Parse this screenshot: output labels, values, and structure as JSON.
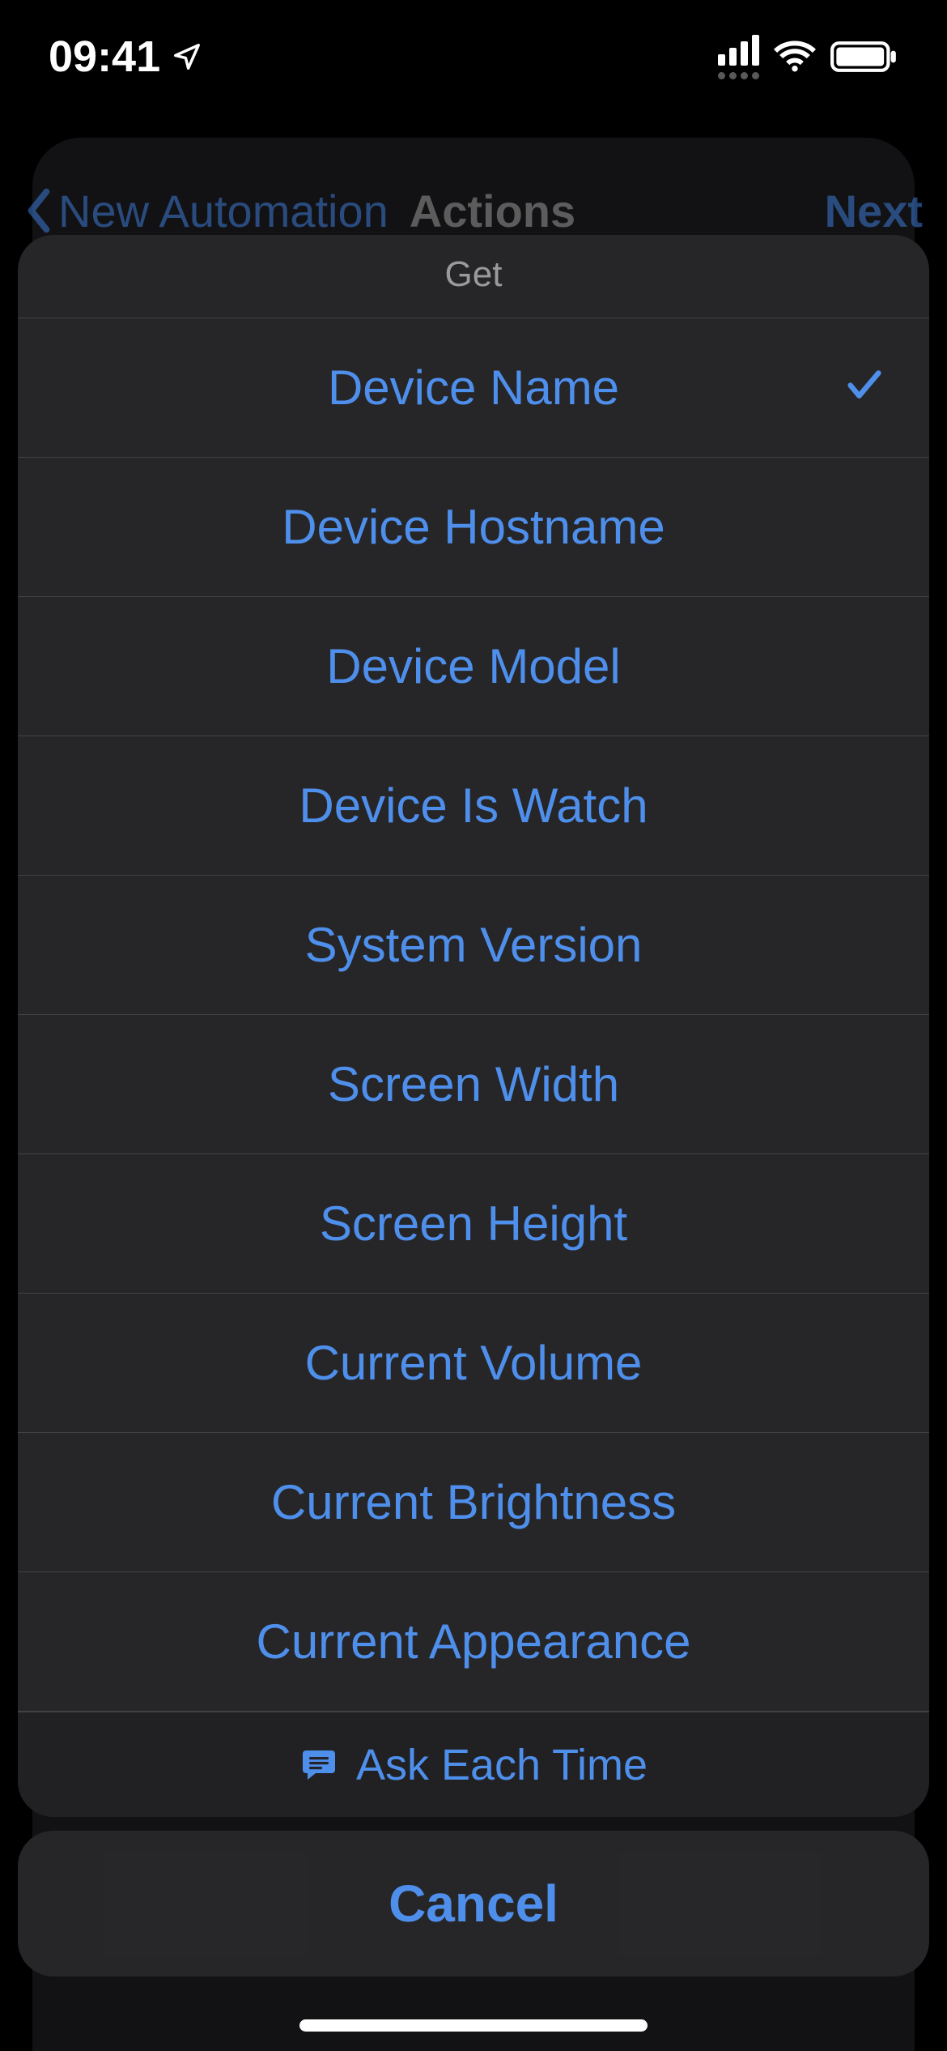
{
  "status": {
    "time": "09:41"
  },
  "nav": {
    "back_label": "New Automation",
    "title": "Actions",
    "next_label": "Next"
  },
  "sheet": {
    "header": "Get",
    "options": [
      {
        "label": "Device Name",
        "selected": true
      },
      {
        "label": "Device Hostname",
        "selected": false
      },
      {
        "label": "Device Model",
        "selected": false
      },
      {
        "label": "Device Is Watch",
        "selected": false
      },
      {
        "label": "System Version",
        "selected": false
      },
      {
        "label": "Screen Width",
        "selected": false
      },
      {
        "label": "Screen Height",
        "selected": false
      },
      {
        "label": "Current Volume",
        "selected": false
      },
      {
        "label": "Current Brightness",
        "selected": false
      },
      {
        "label": "Current Appearance",
        "selected": false
      }
    ],
    "ask_label": "Ask Each Time",
    "cancel_label": "Cancel"
  }
}
